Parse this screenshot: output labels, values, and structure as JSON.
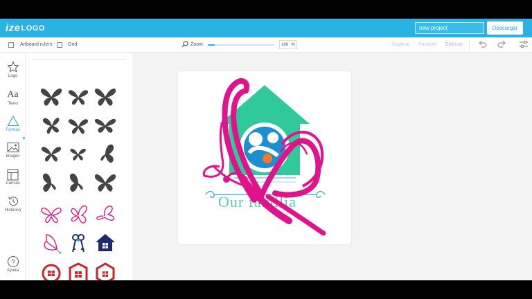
{
  "header": {
    "logo_prefix": "ize",
    "logo_suffix": "LOGO",
    "project_name": "new project",
    "download_label": "Descargar"
  },
  "toolbar": {
    "artboard_rulers_label": "Artboard rulers",
    "grid_label": "Grid",
    "zoom_label": "Zoom",
    "zoom_value": "100",
    "zoom_unit": "%",
    "zoom_level": 0.1,
    "duplicate_label": "Duplicar",
    "position_label": "Posición",
    "delete_label": "Eliminar"
  },
  "leftnav": {
    "items": [
      {
        "label": "Logo",
        "icon": "star-icon"
      },
      {
        "label": "Texto",
        "icon": "text-icon"
      },
      {
        "label": "Formas",
        "icon": "triangle-icon"
      },
      {
        "label": "Imagen",
        "icon": "image-icon"
      },
      {
        "label": "Canvas",
        "icon": "layout-icon"
      },
      {
        "label": "Histórico",
        "icon": "history-icon"
      },
      {
        "label": "Ayuda",
        "icon": "help-icon"
      }
    ],
    "active": "Formas"
  },
  "canvas": {
    "logo_text": "Our familia",
    "colors": {
      "magenta": "#e0138c",
      "teal": "#3fc9a6",
      "house": "#2fc99b",
      "blue": "#1b8fd1",
      "orange": "#f07a2a"
    }
  },
  "colors": {
    "accent": "#29b3e5",
    "dark_shape": "#444444",
    "red_shape": "#c9232e",
    "navy_shape": "#1f2a6b"
  }
}
